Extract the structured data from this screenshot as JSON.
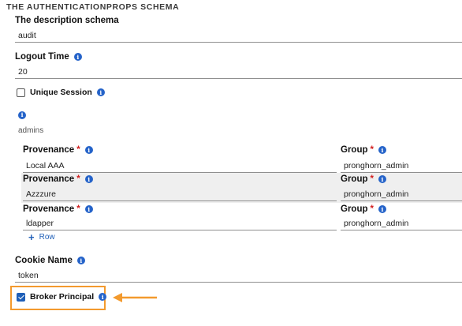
{
  "section_title": "THE AUTHENTICATIONPROPS SCHEMA",
  "description": {
    "label": "The description schema",
    "value": "audit"
  },
  "logout": {
    "label": "Logout Time",
    "value": "20"
  },
  "unique_session": {
    "label": "Unique Session",
    "checked": false
  },
  "admins_label": "admins",
  "table": {
    "provenance_label": "Provenance",
    "group_label": "Group",
    "required_mark": "*",
    "rows": [
      {
        "provenance": "Local AAA",
        "group": "pronghorn_admin"
      },
      {
        "provenance": "Azzzure",
        "group": "pronghorn_admin"
      },
      {
        "provenance": "ldapper",
        "group": "pronghorn_admin"
      }
    ],
    "add_row_label": "Row",
    "add_row_icon": "+"
  },
  "cookie": {
    "label": "Cookie Name",
    "value": "token"
  },
  "broker_principal": {
    "label": "Broker Principal",
    "checked": true
  },
  "info_icon_glyph": "i",
  "colors": {
    "accent": "#1f5fb8",
    "highlight": "#f39a2e",
    "required": "#d21f1f"
  }
}
